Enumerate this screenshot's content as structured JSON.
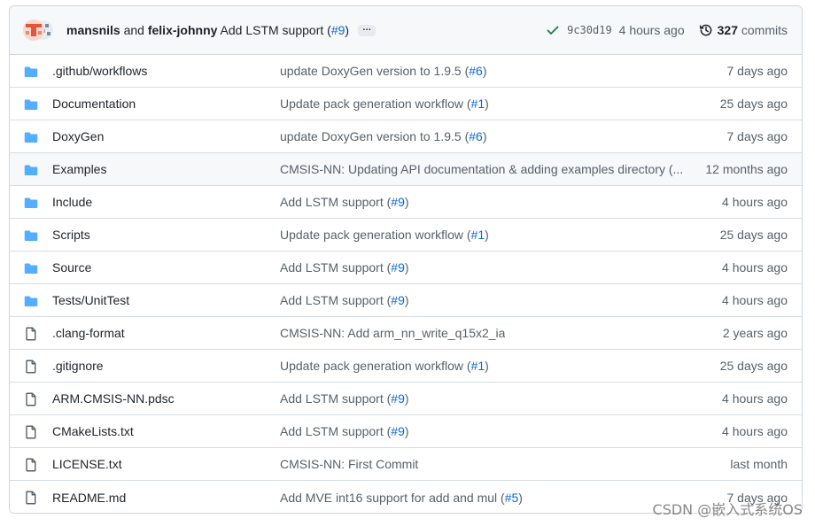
{
  "latest_commit": {
    "author1": "mansnils",
    "and": "and",
    "author2": "felix-johnny",
    "message": "Add LSTM support (",
    "pr": "#9",
    "close": ")",
    "ellipsis": "…",
    "sha": "9c30d19",
    "time": "4 hours ago",
    "commit_count": "327",
    "commit_word": "commits",
    "status_color": "#1a7f37"
  },
  "files": [
    {
      "type": "folder",
      "name": ".github/workflows",
      "msg": "update DoxyGen version to 1.9.5 (",
      "pr": "#6",
      "close": ")",
      "age": "7 days ago"
    },
    {
      "type": "folder",
      "name": "Documentation",
      "msg": "Update pack generation workflow (",
      "pr": "#1",
      "close": ")",
      "age": "25 days ago"
    },
    {
      "type": "folder",
      "name": "DoxyGen",
      "msg": "update DoxyGen version to 1.9.5 (",
      "pr": "#6",
      "close": ")",
      "age": "7 days ago"
    },
    {
      "type": "folder",
      "name": "Examples",
      "msg": "CMSIS-NN: Updating API documentation & adding examples directory (...",
      "pr": "",
      "close": "",
      "age": "12 months ago"
    },
    {
      "type": "folder",
      "name": "Include",
      "msg": "Add LSTM support (",
      "pr": "#9",
      "close": ")",
      "age": "4 hours ago"
    },
    {
      "type": "folder",
      "name": "Scripts",
      "msg": "Update pack generation workflow (",
      "pr": "#1",
      "close": ")",
      "age": "25 days ago"
    },
    {
      "type": "folder",
      "name": "Source",
      "msg": "Add LSTM support (",
      "pr": "#9",
      "close": ")",
      "age": "4 hours ago"
    },
    {
      "type": "folder",
      "name": "Tests/UnitTest",
      "msg": "Add LSTM support (",
      "pr": "#9",
      "close": ")",
      "age": "4 hours ago"
    },
    {
      "type": "file",
      "name": ".clang-format",
      "msg": "CMSIS-NN: Add arm_nn_write_q15x2_ia",
      "pr": "",
      "close": "",
      "age": "2 years ago"
    },
    {
      "type": "file",
      "name": ".gitignore",
      "msg": "Update pack generation workflow (",
      "pr": "#1",
      "close": ")",
      "age": "25 days ago"
    },
    {
      "type": "file",
      "name": "ARM.CMSIS-NN.pdsc",
      "msg": "Add LSTM support (",
      "pr": "#9",
      "close": ")",
      "age": "4 hours ago"
    },
    {
      "type": "file",
      "name": "CMakeLists.txt",
      "msg": "Add LSTM support (",
      "pr": "#9",
      "close": ")",
      "age": "4 hours ago"
    },
    {
      "type": "file",
      "name": "LICENSE.txt",
      "msg": "CMSIS-NN: First Commit",
      "pr": "",
      "close": "",
      "age": "last month"
    },
    {
      "type": "file",
      "name": "README.md",
      "msg": "Add MVE int16 support for add and mul (",
      "pr": "#5",
      "close": ")",
      "age": "7 days ago"
    }
  ],
  "hovered_row_index": 3,
  "icon_names": {
    "folder": "folder-icon",
    "file": "file-icon"
  },
  "colors": {
    "folder": "#54aeff",
    "link": "#0969da",
    "muted": "#57606a"
  },
  "watermark": "CSDN @嵌入式系统OS"
}
